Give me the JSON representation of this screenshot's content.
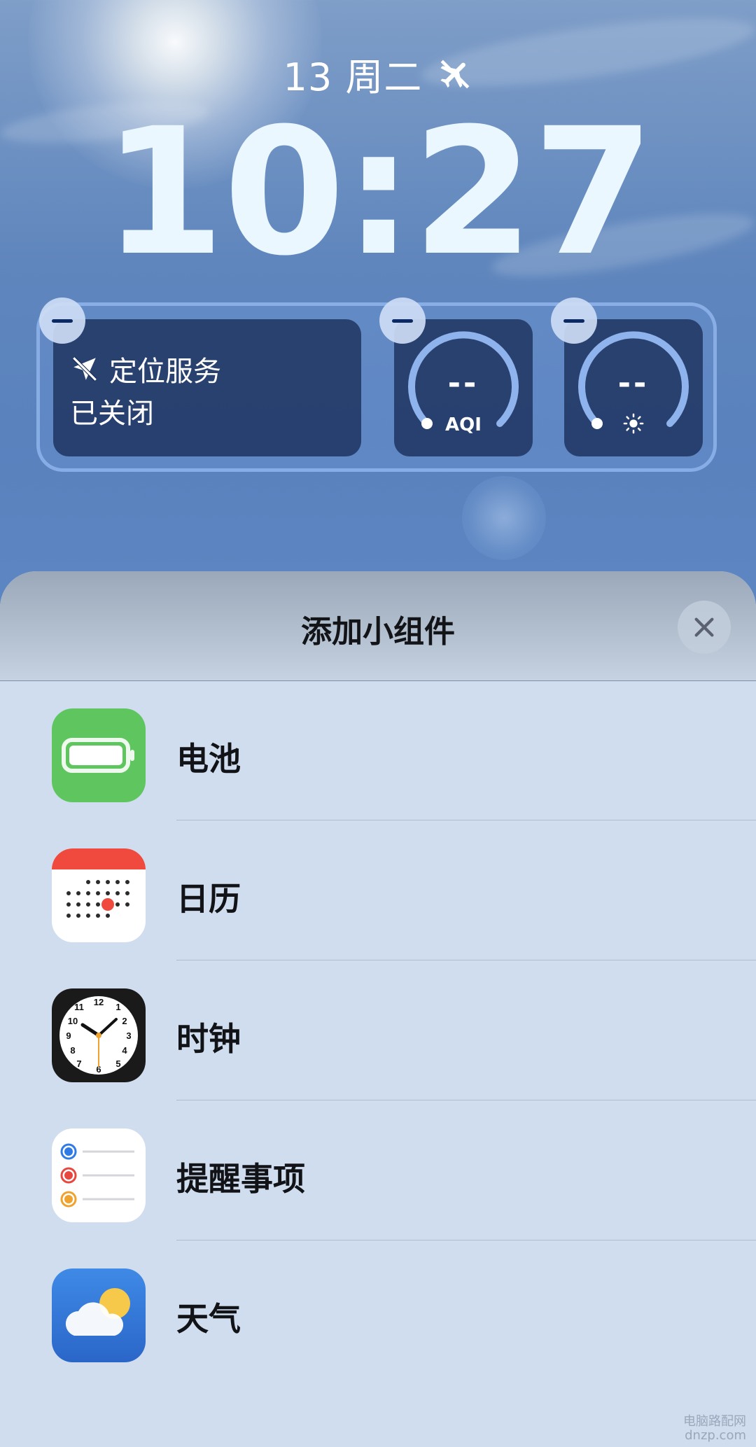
{
  "lockscreen": {
    "date": "13 周二",
    "time": "10:27"
  },
  "widgets": {
    "location": {
      "line1": "定位服务",
      "line2": "已关闭"
    },
    "aqi": {
      "value": "--",
      "label": "AQI"
    },
    "uv": {
      "value": "--"
    }
  },
  "sheet": {
    "title": "添加小组件",
    "apps": [
      {
        "label": "电池",
        "icon": "battery-app-icon"
      },
      {
        "label": "日历",
        "icon": "calendar-app-icon"
      },
      {
        "label": "时钟",
        "icon": "clock-app-icon"
      },
      {
        "label": "提醒事项",
        "icon": "reminders-app-icon"
      },
      {
        "label": "天气",
        "icon": "weather-app-icon"
      }
    ]
  },
  "watermark": {
    "line1": "电脑路配网",
    "line2": "dnzp.com"
  },
  "colors": {
    "battery_green": "#5fc65f",
    "calendar_red": "#ef4a3d",
    "reminder_blue": "#2f7be6",
    "reminder_red": "#e8473f",
    "reminder_orange": "#f0a22e",
    "weather_blue": "#2f74d6",
    "sun_yellow": "#f6c94a"
  }
}
